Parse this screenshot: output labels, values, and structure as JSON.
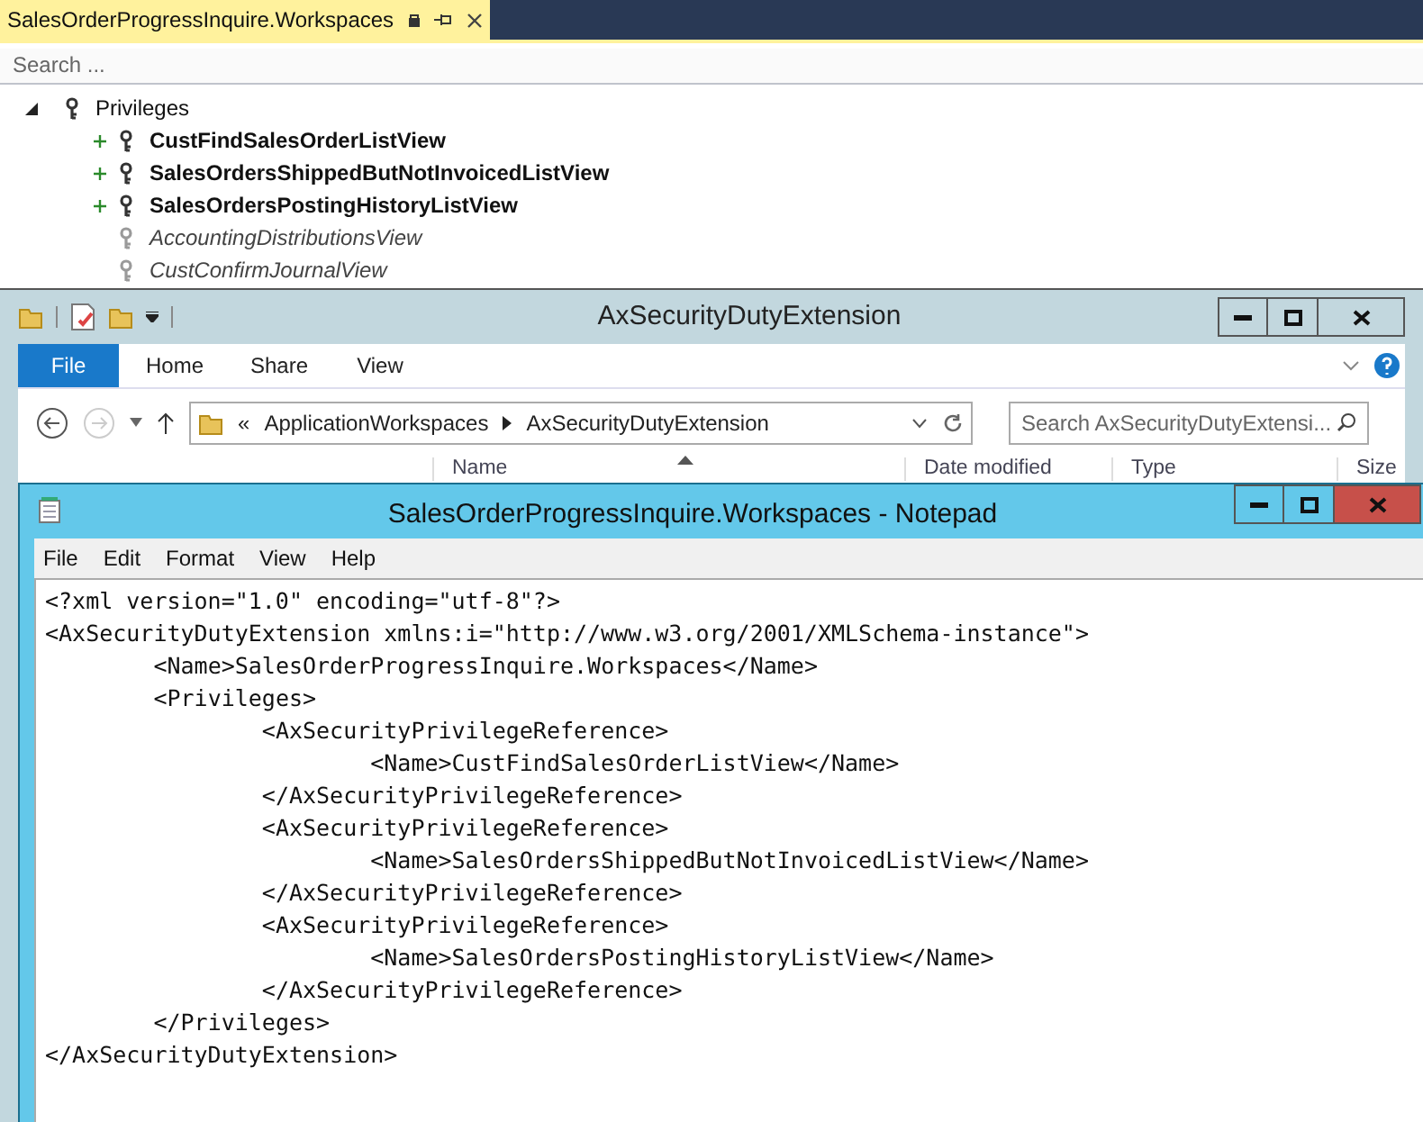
{
  "tool_window": {
    "tab_title": "SalesOrderProgressInquire.Workspaces",
    "search": {
      "placeholder": "Search ..."
    },
    "tree": [
      {
        "label": "Privileges",
        "expanded": true,
        "children": [
          {
            "label": "CustFindSalesOrderListView",
            "kind": "bold"
          },
          {
            "label": "SalesOrdersShippedButNotInvoicedListView",
            "kind": "bold"
          },
          {
            "label": "SalesOrdersPostingHistoryListView",
            "kind": "bold"
          },
          {
            "label": "AccountingDistributionsView",
            "kind": "italic"
          },
          {
            "label": "CustConfirmJournalView",
            "kind": "italic"
          }
        ]
      }
    ]
  },
  "explorer": {
    "title": "AxSecurityDutyExtension",
    "tabs": [
      {
        "label": "File",
        "selected": true
      },
      {
        "label": "Home",
        "selected": false
      },
      {
        "label": "Share",
        "selected": false
      },
      {
        "label": "View",
        "selected": false
      }
    ],
    "breadcrumb": [
      "«",
      "ApplicationWorkspaces",
      "AxSecurityDutyExtension"
    ],
    "search": {
      "placeholder": "Search AxSecurityDutyExtensi..."
    },
    "columns": [
      "Name",
      "Date modified",
      "Type",
      "Size"
    ]
  },
  "notepad": {
    "title": "SalesOrderProgressInquire.Workspaces - Notepad",
    "menu": [
      "File",
      "Edit",
      "Format",
      "View",
      "Help"
    ],
    "lines": [
      "<?xml version=\"1.0\" encoding=\"utf-8\"?>",
      "<AxSecurityDutyExtension xmlns:i=\"http://www.w3.org/2001/XMLSchema-instance\">",
      "\t<Name>SalesOrderProgressInquire.Workspaces</Name>",
      "\t<Privileges>",
      "\t\t<AxSecurityPrivilegeReference>",
      "\t\t\t<Name>CustFindSalesOrderListView</Name>",
      "\t\t</AxSecurityPrivilegeReference>",
      "\t\t<AxSecurityPrivilegeReference>",
      "\t\t\t<Name>SalesOrdersShippedButNotInvoicedListView</Name>",
      "\t\t</AxSecurityPrivilegeReference>",
      "\t\t<AxSecurityPrivilegeReference>",
      "\t\t\t<Name>SalesOrdersPostingHistoryListView</Name>",
      "\t\t</AxSecurityPrivilegeReference>",
      "\t</Privileges>",
      "</AxSecurityDutyExtension>"
    ]
  }
}
